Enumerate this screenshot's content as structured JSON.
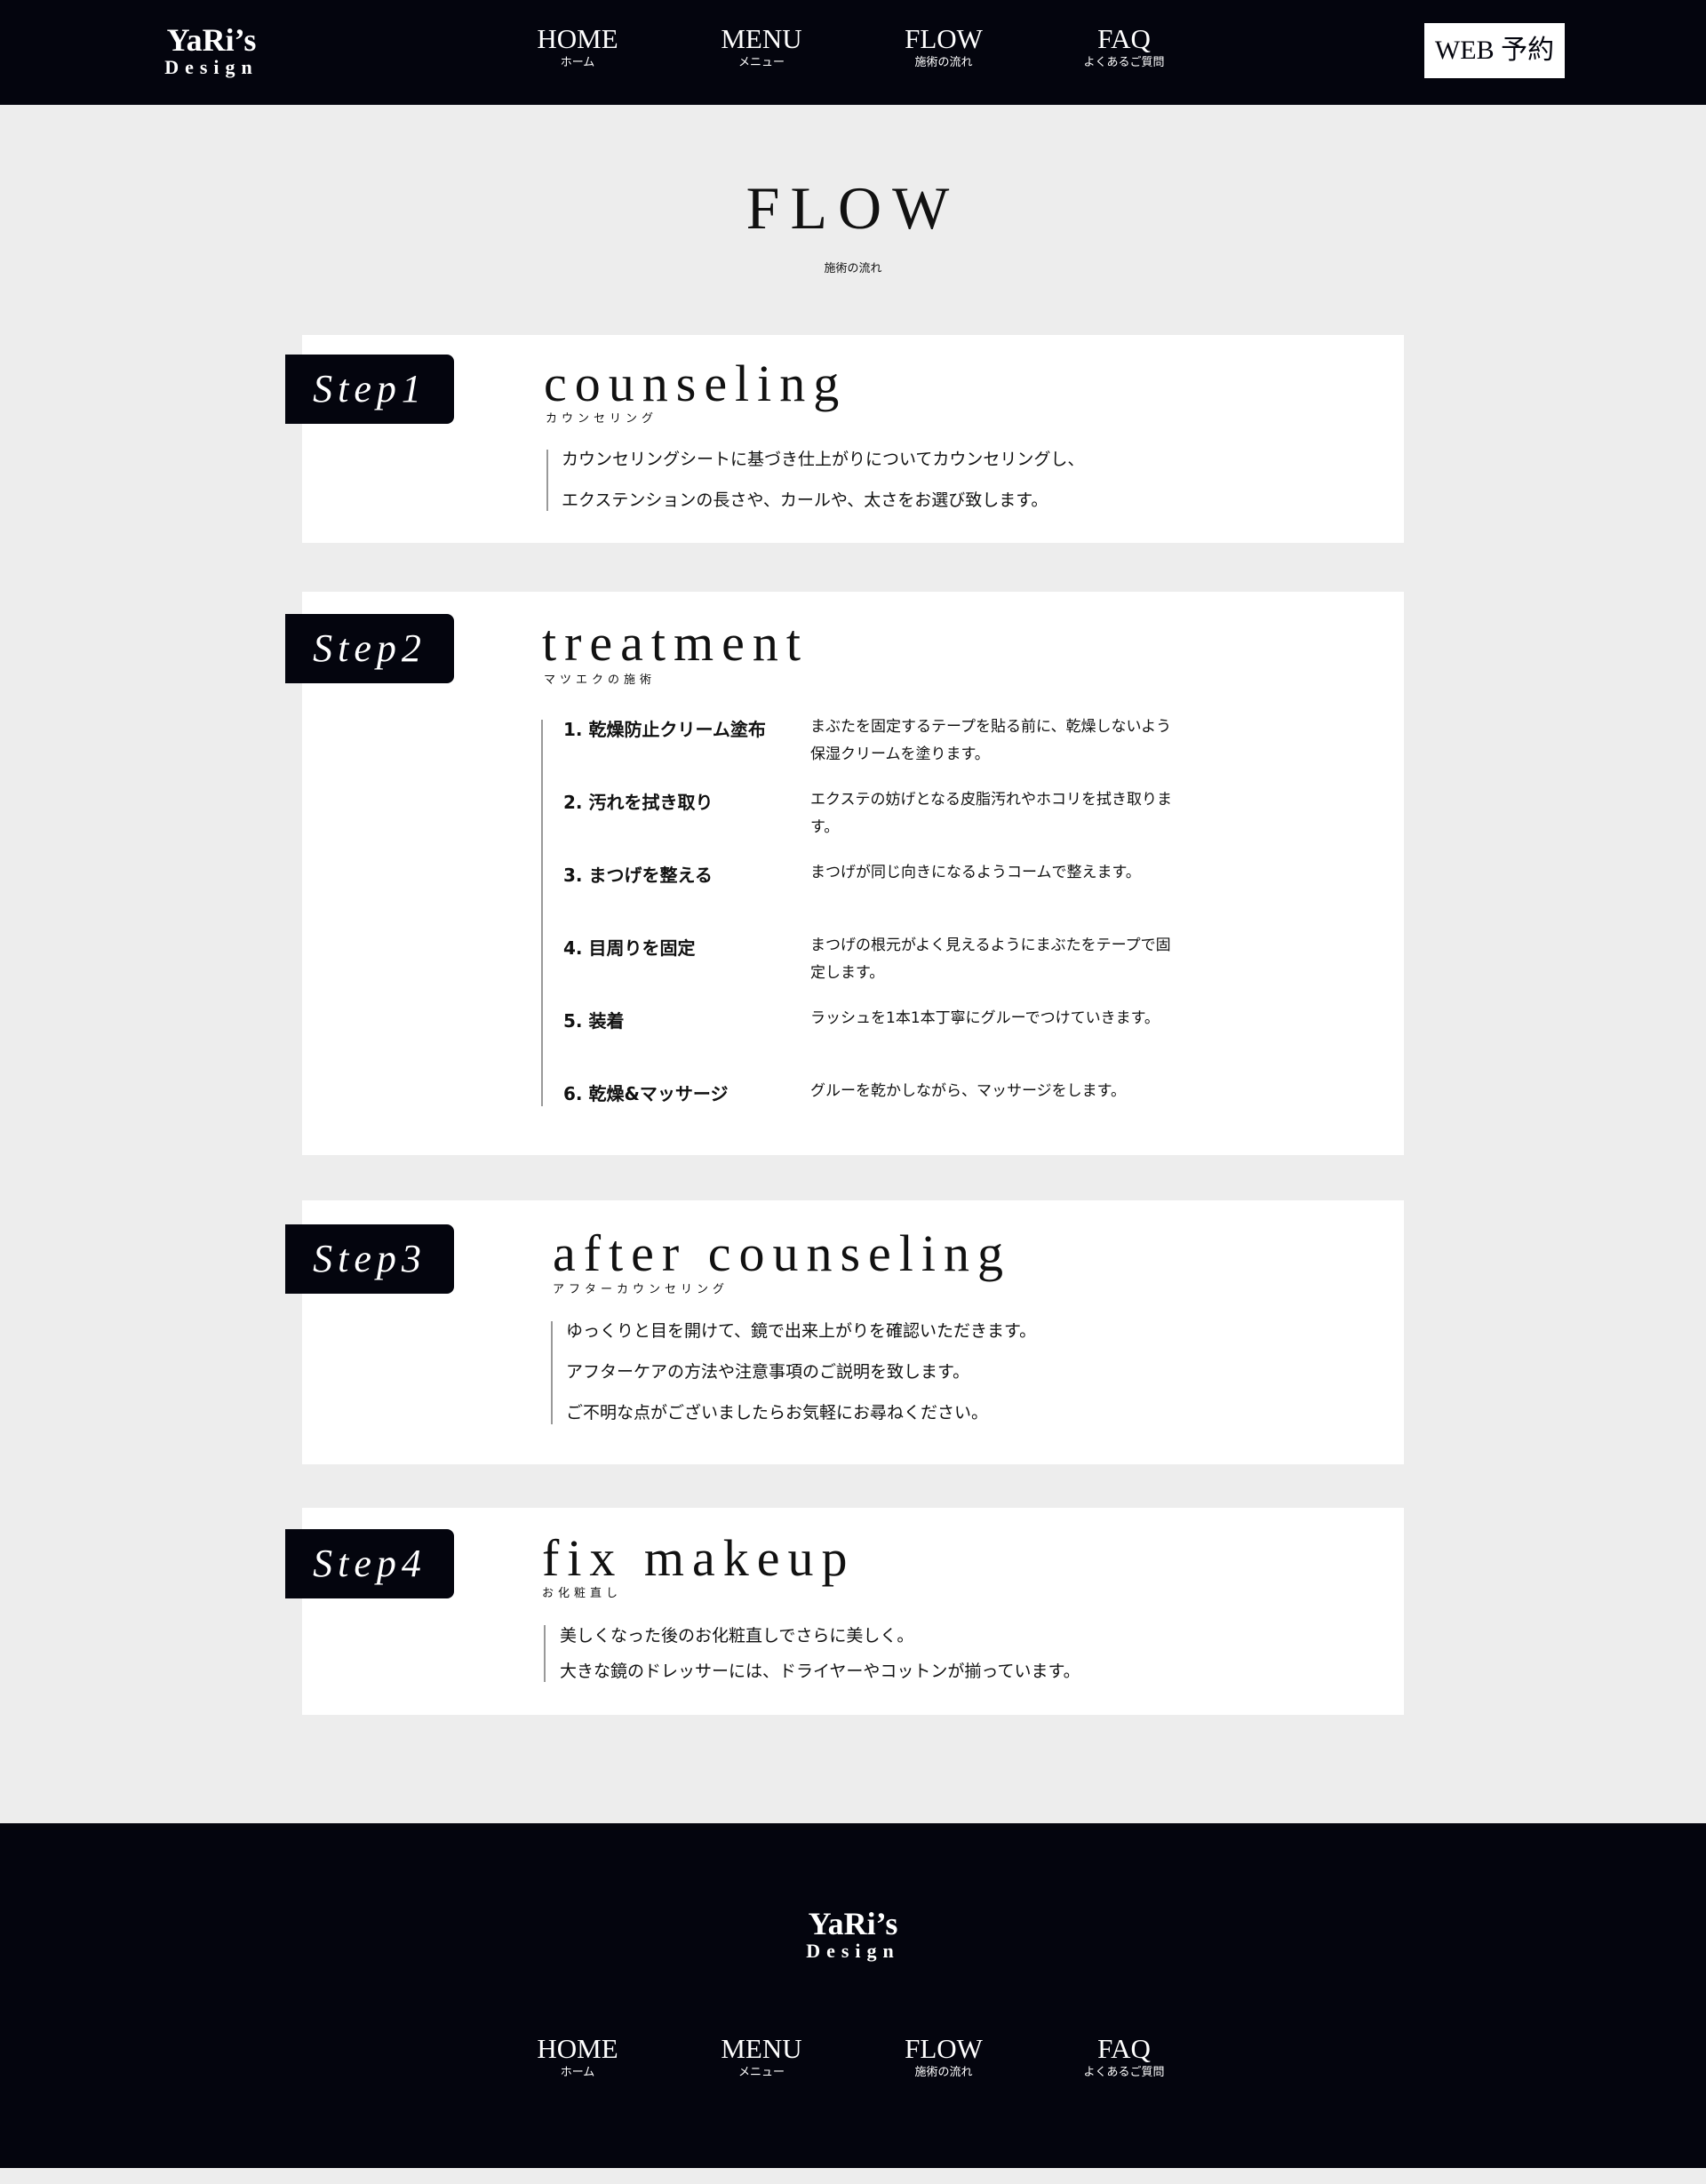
{
  "header": {
    "logo_line1": "YaRi’s",
    "logo_line2": "Design",
    "nav": [
      {
        "en": "HOME",
        "ja": "ホーム"
      },
      {
        "en": "MENU",
        "ja": "メニュー"
      },
      {
        "en": "FLOW",
        "ja": "施術の流れ"
      },
      {
        "en": "FAQ",
        "ja": "よくあるご質問"
      }
    ],
    "web_button": "WEB 予約"
  },
  "main": {
    "title": "FLOW",
    "subtitle": "施術の流れ",
    "steps": [
      {
        "badge": "Step1",
        "title": "counseling",
        "subtitle": "カウンセリング",
        "lines": [
          "カウンセリングシートに基づき仕上がりについてカウンセリングし、",
          "エクステンションの長さや、カールや、太さをお選び致します。"
        ]
      },
      {
        "badge": "Step2",
        "title": "treatment",
        "subtitle": "マツエクの施術",
        "items": [
          {
            "label": "1. 乾燥防止クリーム塗布",
            "desc": "まぶたを固定するテープを貼る前に、乾燥しないよう保湿クリームを塗ります。"
          },
          {
            "label": "2. 汚れを拭き取り",
            "desc": "エクステの妨げとなる皮脂汚れやホコリを拭き取ります。"
          },
          {
            "label": "3. まつげを整える",
            "desc": "まつげが同じ向きになるようコームで整えます。"
          },
          {
            "label": "4. 目周りを固定",
            "desc": "まつげの根元がよく見えるようにまぶたをテープで固定します。"
          },
          {
            "label": "5. 装着",
            "desc": "ラッシュを1本1本丁寧にグルーでつけていきます。"
          },
          {
            "label": "6. 乾燥&マッサージ",
            "desc": "グルーを乾かしながら、マッサージをします。"
          }
        ]
      },
      {
        "badge": "Step3",
        "title": "after counseling",
        "subtitle": "アフターカウンセリング",
        "lines": [
          "ゆっくりと目を開けて、鏡で出来上がりを確認いただきます。",
          "アフターケアの方法や注意事項のご説明を致します。",
          "ご不明な点がございましたらお気軽にお尋ねください。"
        ]
      },
      {
        "badge": "Step4",
        "title": "fix makeup",
        "subtitle": "お化粧直し",
        "lines": [
          "美しくなった後のお化粧直しでさらに美しく。",
          "大きな鏡のドレッサーには、ドライヤーやコットンが揃っています。"
        ]
      }
    ]
  },
  "footer": {
    "logo_line1": "YaRi’s",
    "logo_line2": "Design",
    "nav": [
      {
        "en": "HOME",
        "ja": "ホーム"
      },
      {
        "en": "MENU",
        "ja": "メニュー"
      },
      {
        "en": "FLOW",
        "ja": "施術の流れ"
      },
      {
        "en": "FAQ",
        "ja": "よくあるご質問"
      }
    ]
  },
  "colors": {
    "navy": "#04050e",
    "page_bg": "#ededed",
    "card_bg": "#ffffff",
    "rule": "#999999"
  }
}
